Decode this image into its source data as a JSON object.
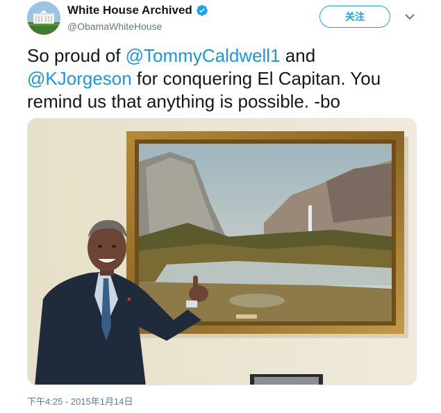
{
  "header": {
    "display_name": "White House Archived",
    "handle": "@ObamaWhiteHouse",
    "follow_label": "关注",
    "verified": true
  },
  "tweet": {
    "text_1": "So proud of ",
    "mention_1": "@TommyCaldwell1",
    "text_2": " and ",
    "mention_2": "@KJorgeson",
    "text_3": " for conquering El Capitan. You remind us that anything is possible. -bo"
  },
  "media": {
    "subject": "photo of man pointing at framed landscape painting of El Capitan"
  },
  "timestamp": "下午4:25 - 2015年1月14日",
  "colors": {
    "accent": "#1da1f2",
    "mention": "#1b95e0",
    "muted": "#657786",
    "text": "#14171a"
  },
  "icons": {
    "verified": "verified-badge-icon",
    "caret": "chevron-down-icon"
  }
}
